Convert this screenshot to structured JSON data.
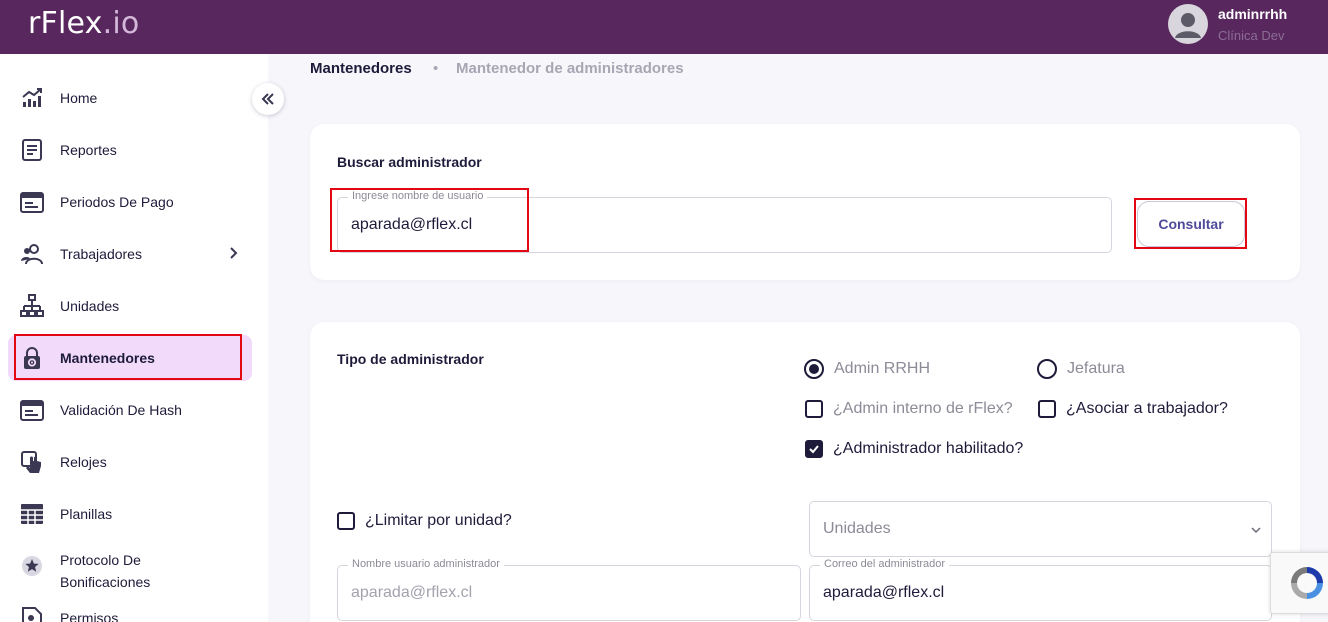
{
  "header": {
    "logo_main": "rFlex",
    "logo_suffix": ".io",
    "user_name": "adminrrhh",
    "user_org": "Clínica Dev"
  },
  "sidebar": {
    "items": [
      {
        "label": "Home",
        "icon": "chart-line-icon"
      },
      {
        "label": "Reportes",
        "icon": "document-icon"
      },
      {
        "label": "Periodos De Pago",
        "icon": "calendar-card-icon"
      },
      {
        "label": "Trabajadores",
        "icon": "users-icon",
        "has_submenu": true
      },
      {
        "label": "Unidades",
        "icon": "org-chart-icon"
      },
      {
        "label": "Mantenedores",
        "icon": "lock-gear-icon",
        "active": true
      },
      {
        "label": "Validación De Hash",
        "icon": "calendar-card-icon"
      },
      {
        "label": "Relojes",
        "icon": "touch-icon"
      },
      {
        "label": "Planillas",
        "icon": "table-icon"
      },
      {
        "label": "Protocolo De Bonificaciones",
        "icon": "star-badge-icon"
      },
      {
        "label": "Permisos",
        "icon": "document-person-icon"
      }
    ]
  },
  "breadcrumb": {
    "root": "Mantenedores",
    "separator": "•",
    "current": "Mantenedor de administradores"
  },
  "search": {
    "title": "Buscar administrador",
    "field_label": "Ingrese nombre de usuario",
    "value": "aparada@rflex.cl",
    "button_label": "Consultar"
  },
  "admin_form": {
    "title": "Tipo de administrador",
    "radio_admin_rrhh": "Admin RRHH",
    "radio_jefatura": "Jefatura",
    "selected_type": "Admin RRHH",
    "check_admin_interno": "¿Admin interno de rFlex?",
    "check_admin_interno_checked": false,
    "check_asociar": "¿Asociar a trabajador?",
    "check_asociar_checked": false,
    "check_habilitado": "¿Administrador habilitado?",
    "check_habilitado_checked": true,
    "check_limitar": "¿Limitar por unidad?",
    "check_limitar_checked": false,
    "unidades_placeholder": "Unidades",
    "username_label": "Nombre usuario administrador",
    "username_value": "aparada@rflex.cl",
    "email_label": "Correo del administrador",
    "email_value": "aparada@rflex.cl"
  },
  "colors": {
    "header_bg": "#58275e",
    "active_nav_bg": "#f1dafa",
    "highlight": "#e30613",
    "primary_text": "#1e1b3a"
  }
}
